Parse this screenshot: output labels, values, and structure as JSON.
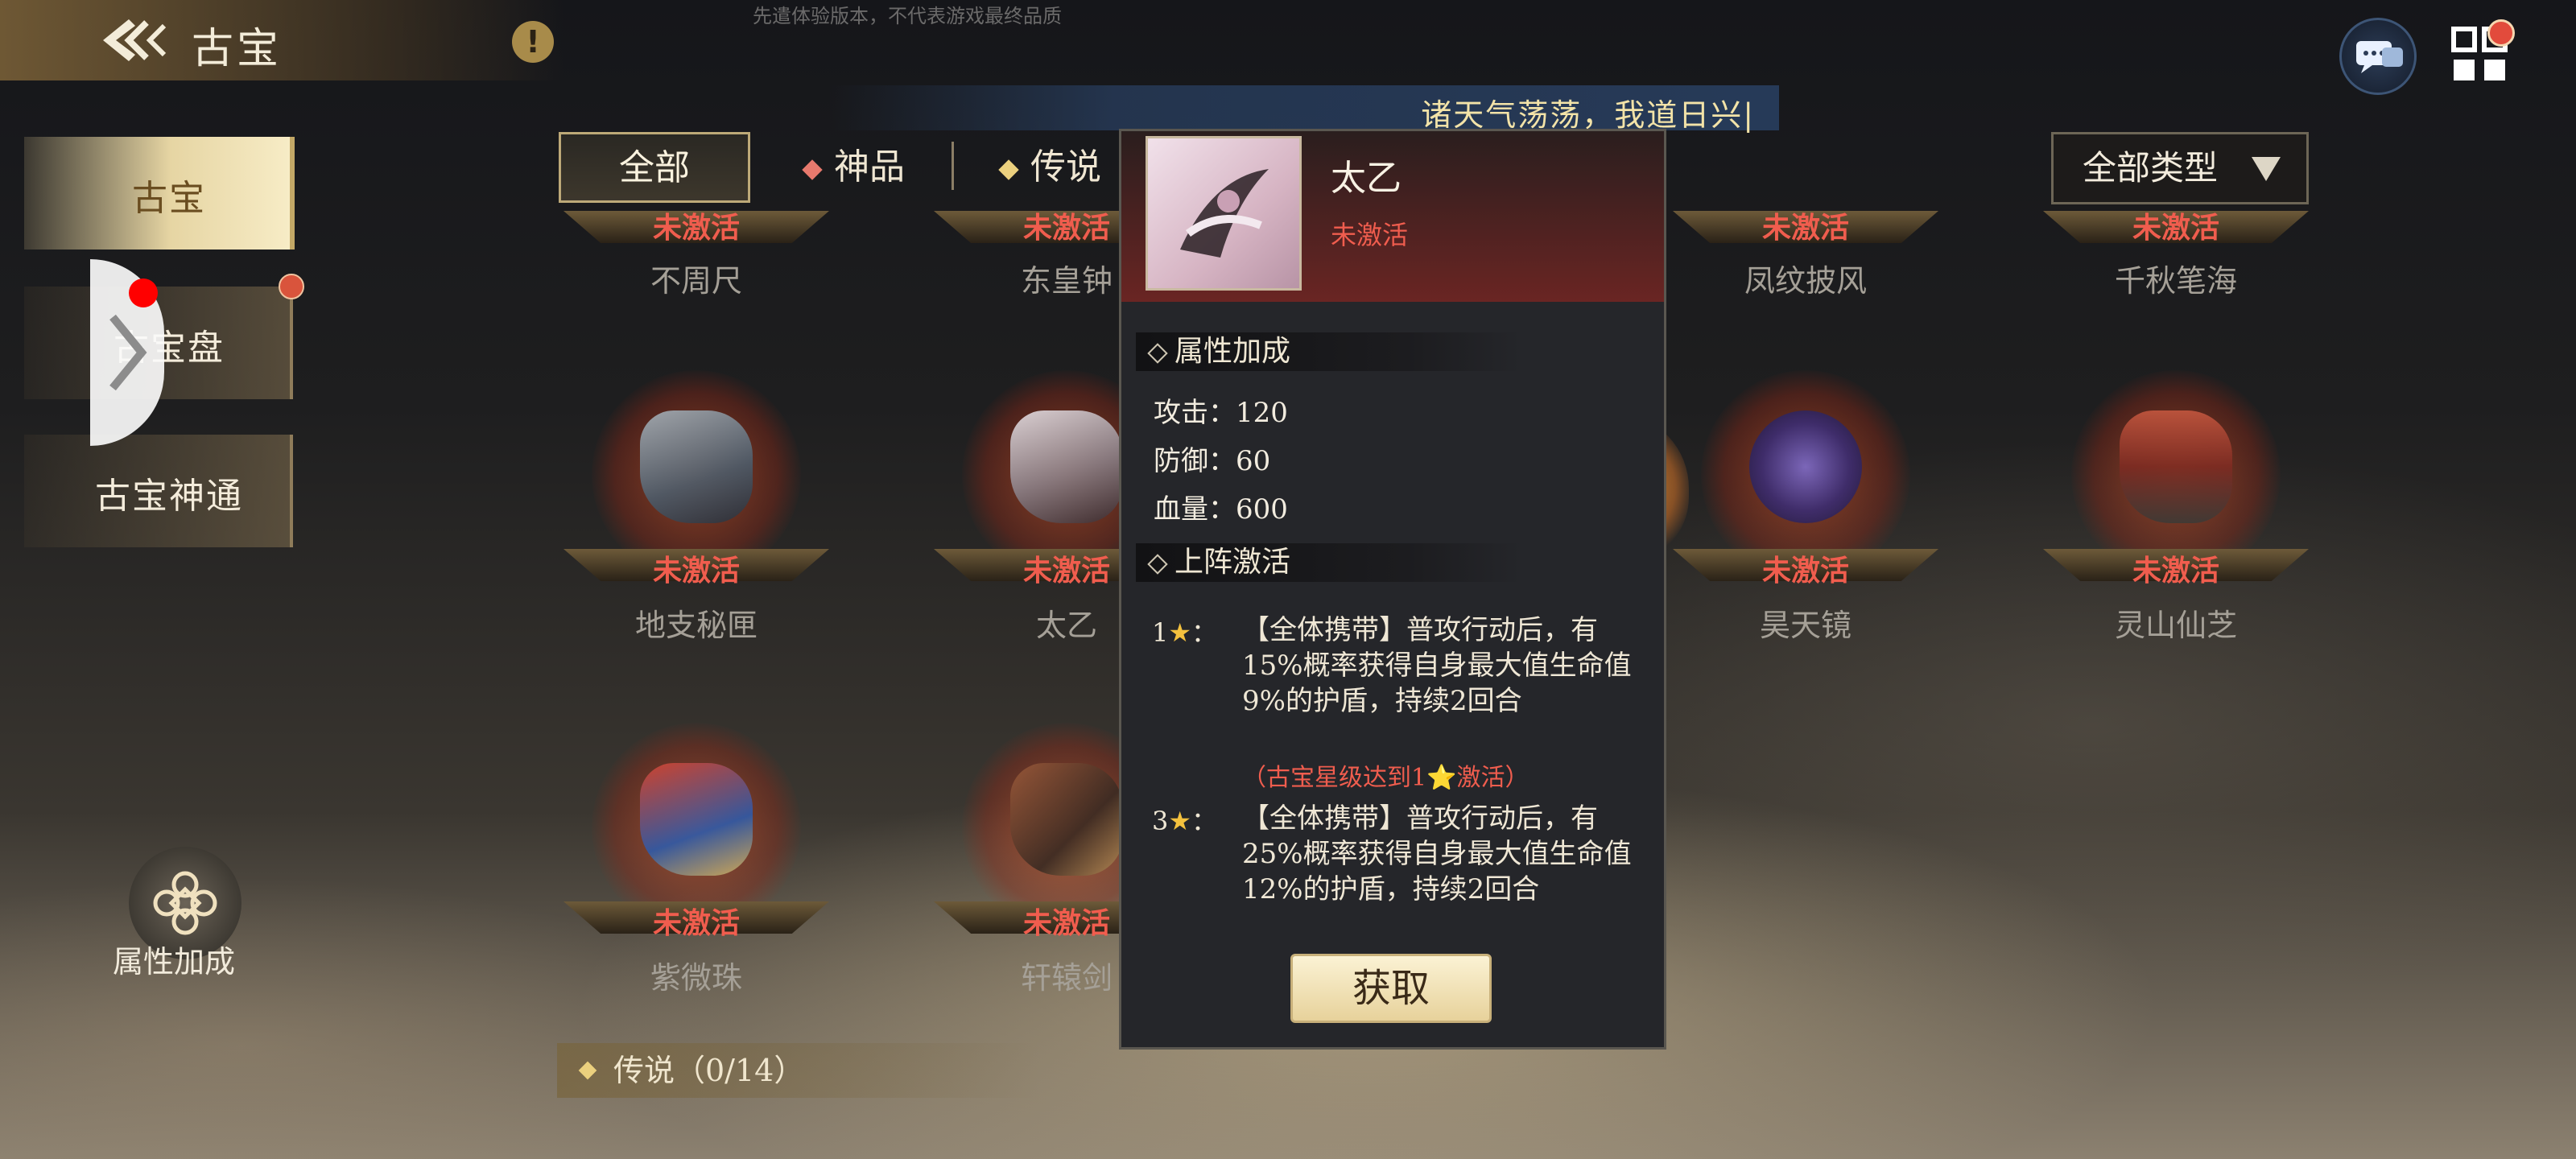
{
  "header": {
    "title": "古宝",
    "watermark": "先遣体验版本，不代表游戏最终品质",
    "info_icon_text": "!"
  },
  "announcement": "诸天气荡荡，我道日兴|",
  "sidebar": {
    "items": [
      {
        "label": "古宝"
      },
      {
        "label": "古宝盘"
      },
      {
        "label": "古宝神通"
      }
    ],
    "attr_button_label": "属性加成"
  },
  "filters": {
    "tabs": [
      {
        "label": "全部"
      },
      {
        "label": "神品"
      },
      {
        "label": "传说"
      }
    ],
    "type_select": "全部类型"
  },
  "items_row1": [
    {
      "name": "不周尺",
      "status": "未激活"
    },
    {
      "name": "东皇钟",
      "status": "未激活"
    },
    {
      "name": "凤纹披风",
      "status": "未激活"
    },
    {
      "name": "千秋笔海",
      "status": "未激活"
    }
  ],
  "items_row2": [
    {
      "name": "地支秘匣",
      "status": "未激活"
    },
    {
      "name": "太乙",
      "status": "未激活"
    },
    {
      "name": "昊天镜",
      "status": "未激活"
    },
    {
      "name": "灵山仙芝",
      "status": "未激活"
    }
  ],
  "items_row3": [
    {
      "name": "紫微珠",
      "status": "未激活"
    },
    {
      "name": "轩辕剑",
      "status": "未激活"
    }
  ],
  "legend_section": "传说（0/14）",
  "detail": {
    "name": "太乙",
    "status": "未激活",
    "attr_title": "属性加成",
    "stats": [
      {
        "text": "攻击：120"
      },
      {
        "text": "防御：60"
      },
      {
        "text": "血量：600"
      }
    ],
    "activation_title": "上阵激活",
    "effects": [
      {
        "level": "1",
        "text": "【全体携带】普攻行动后，有15%概率获得自身最大值生命值9%的护盾，持续2回合",
        "condition": "（古宝星级达到1⭐激活）"
      },
      {
        "level": "3",
        "text": "【全体携带】普攻行动后，有25%概率获得自身最大值生命值12%的护盾，持续2回合"
      }
    ],
    "obtain_label": "获取"
  },
  "colors": {
    "inactive_red": "#f05d4e",
    "gold": "#e6d5a3",
    "star": "#f4c13e"
  }
}
